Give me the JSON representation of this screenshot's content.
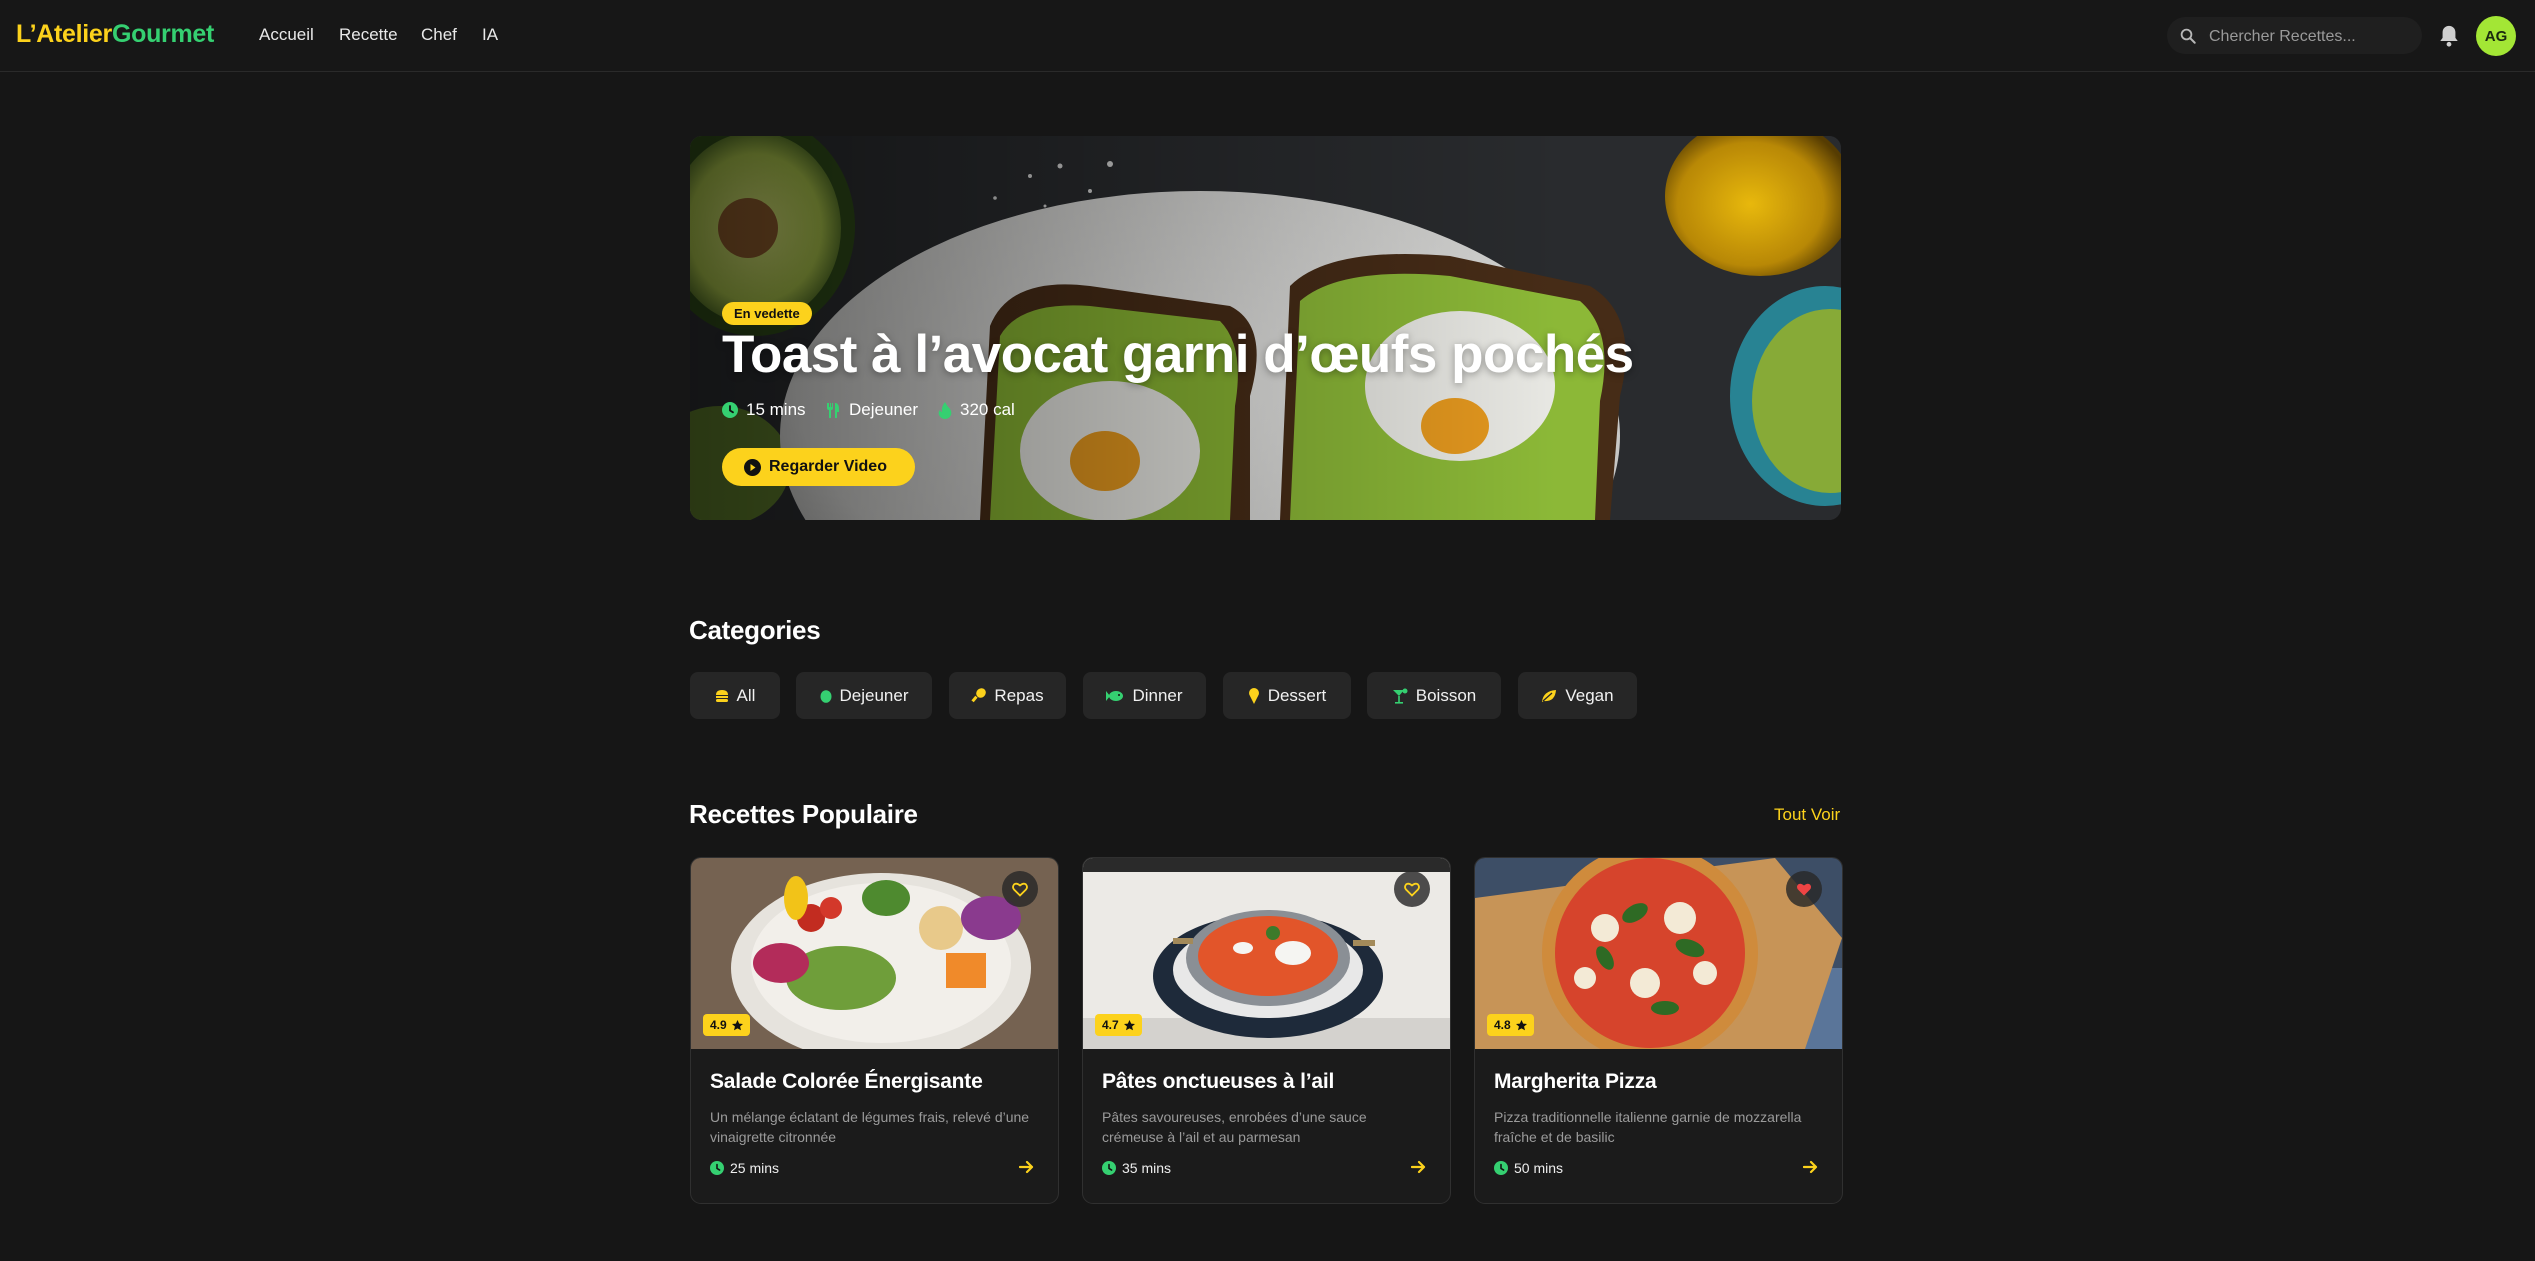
{
  "nav": {
    "logo_part1": "L’Atelier",
    "logo_part2": "Gourmet",
    "links": [
      "Accueil",
      "Recette",
      "Chef",
      "IA"
    ],
    "search_placeholder": "Chercher Recettes...",
    "avatar_initials": "AG"
  },
  "hero": {
    "badge": "En vedette",
    "title": "Toast à l’avocat garni d’œufs pochés",
    "time": "15 mins",
    "meal": "Dejeuner",
    "calories": "320 cal",
    "button": "Regarder Video"
  },
  "categories": {
    "title": "Categories",
    "items": [
      {
        "label": "All",
        "icon": "burger-icon"
      },
      {
        "label": "Dejeuner",
        "icon": "egg-icon"
      },
      {
        "label": "Repas",
        "icon": "drumstick-icon"
      },
      {
        "label": "Dinner",
        "icon": "fish-icon"
      },
      {
        "label": "Dessert",
        "icon": "ice-cream-icon"
      },
      {
        "label": "Boisson",
        "icon": "cocktail-icon"
      },
      {
        "label": "Vegan",
        "icon": "leaf-icon"
      }
    ]
  },
  "popular": {
    "title": "Recettes Populaire",
    "see_all": "Tout Voir",
    "recipes": [
      {
        "title": "Salade Colorée Énergisante",
        "desc": "Un mélange éclatant de légumes frais, relevé d’une vinaigrette citronnée",
        "time": "25 mins",
        "rating": "4.9",
        "favorited": false
      },
      {
        "title": "Pâtes onctueuses à l’ail",
        "desc": "Pâtes savoureuses, enrobées d’une sauce crémeuse à l’ail et au parmesan",
        "time": "35 mins",
        "rating": "4.7",
        "favorited": false
      },
      {
        "title": "Margherita Pizza",
        "desc": "Pizza traditionnelle italienne garnie de mozzarella fraîche et de basilic",
        "time": "50 mins",
        "rating": "4.8",
        "favorited": true
      }
    ]
  },
  "colors": {
    "accent": "#fcd21c",
    "green": "#35d071",
    "favorite": "#ef4444"
  }
}
